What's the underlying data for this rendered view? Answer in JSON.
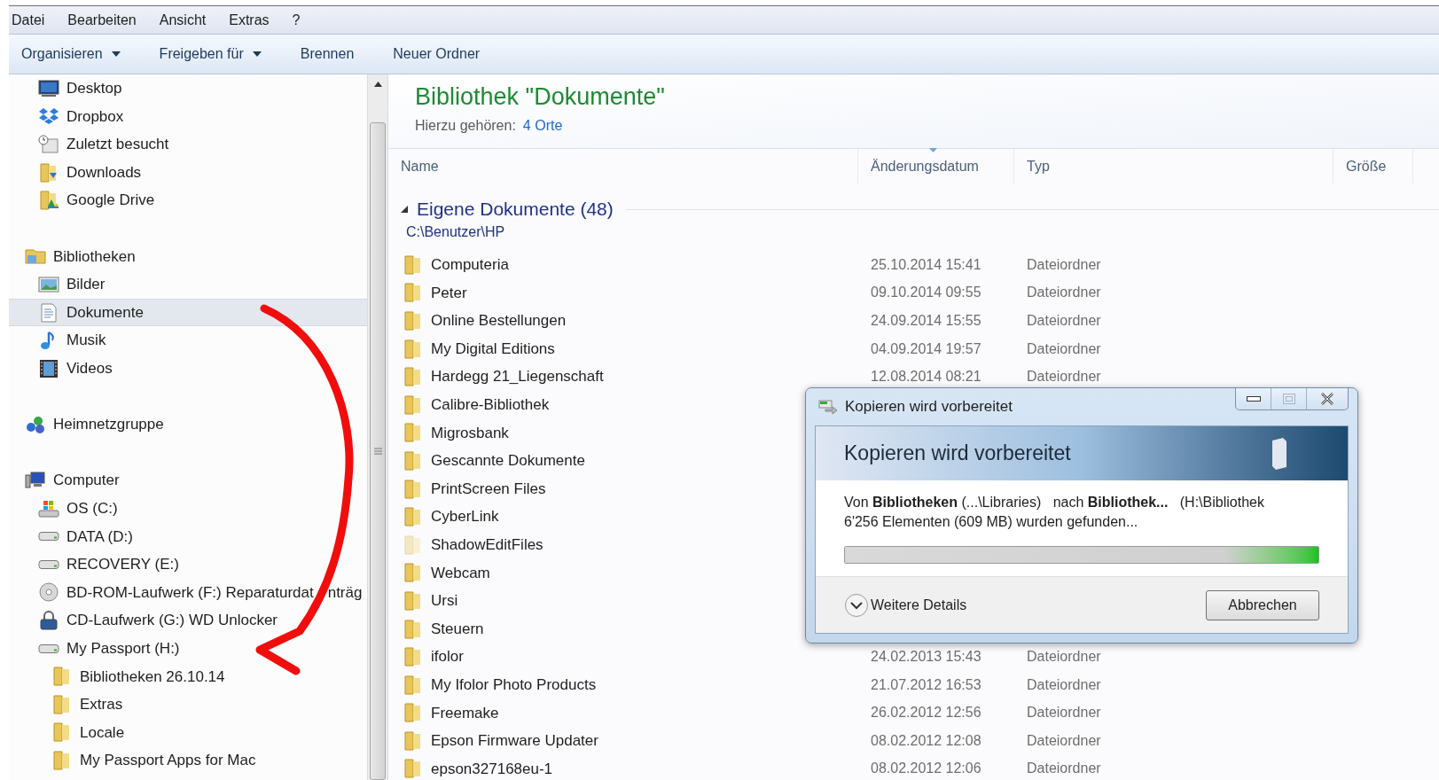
{
  "menu_bar": [
    "Datei",
    "Bearbeiten",
    "Ansicht",
    "Extras",
    "?"
  ],
  "toolbar": [
    {
      "label": "Organisieren",
      "dropdown": true
    },
    {
      "label": "Freigeben für",
      "dropdown": true
    },
    {
      "label": "Brennen",
      "dropdown": false
    },
    {
      "label": "Neuer Ordner",
      "dropdown": false
    }
  ],
  "sidebar": {
    "sections": [
      [
        {
          "label": "Desktop",
          "kind": "desktop",
          "selected": false
        },
        {
          "label": "Dropbox",
          "kind": "dropbox",
          "selected": false
        },
        {
          "label": "Zuletzt besucht",
          "kind": "recent",
          "selected": false
        },
        {
          "label": "Downloads",
          "kind": "downloads",
          "selected": false
        },
        {
          "label": "Google Drive",
          "kind": "gdrive",
          "selected": false
        }
      ],
      [
        {
          "label": "Bibliotheken",
          "kind": "library",
          "selected": false,
          "children": [
            {
              "label": "Bilder",
              "kind": "pictures",
              "selected": false
            },
            {
              "label": "Dokumente",
              "kind": "documents",
              "selected": true
            },
            {
              "label": "Musik",
              "kind": "music",
              "selected": false
            },
            {
              "label": "Videos",
              "kind": "videos",
              "selected": false
            }
          ]
        }
      ],
      [
        {
          "label": "Heimnetzgruppe",
          "kind": "homegroup",
          "selected": false
        }
      ],
      [
        {
          "label": "Computer",
          "kind": "computer",
          "selected": false,
          "children": [
            {
              "label": "OS (C:)",
              "kind": "osdrive",
              "selected": false
            },
            {
              "label": "DATA (D:)",
              "kind": "drive",
              "selected": false
            },
            {
              "label": "RECOVERY (E:)",
              "kind": "drive",
              "selected": false
            },
            {
              "label": "BD-ROM-Laufwerk (F:) Reparaturdat",
              "label_after_arrow": "nträg",
              "kind": "optical",
              "selected": false
            },
            {
              "label": "CD-Laufwerk (G:) WD Unlocker",
              "kind": "cdlock",
              "selected": false
            },
            {
              "label": "My Passport (H:)",
              "kind": "drive",
              "selected": false,
              "children": [
                {
                  "label": "Bibliotheken 26.10.14",
                  "kind": "folder",
                  "selected": false
                },
                {
                  "label": "Extras",
                  "kind": "folder",
                  "selected": false
                },
                {
                  "label": "Locale",
                  "kind": "folder",
                  "selected": false
                },
                {
                  "label": "My Passport Apps for Mac",
                  "kind": "folder",
                  "selected": false
                }
              ]
            }
          ]
        }
      ]
    ]
  },
  "library": {
    "title": "Bibliothek \"Dokumente\"",
    "includes_label": "Hierzu gehören:",
    "includes_link": "4 Orte"
  },
  "table": {
    "columns": [
      {
        "label": "Name",
        "sorted": false
      },
      {
        "label": "Änderungsdatum",
        "sorted": true
      },
      {
        "label": "Typ",
        "sorted": false
      },
      {
        "label": "Größe",
        "sorted": false
      }
    ],
    "group": {
      "title": "Eigene Dokumente (48)",
      "path": "C:\\Benutzer\\HP",
      "expanded": true
    },
    "rows": [
      {
        "name": "Computeria",
        "date": "25.10.2014 15:41",
        "type": "Dateiordner",
        "faded": false
      },
      {
        "name": "Peter",
        "date": "09.10.2014 09:55",
        "type": "Dateiordner",
        "faded": false
      },
      {
        "name": "Online Bestellungen",
        "date": "24.09.2014 15:55",
        "type": "Dateiordner",
        "faded": false
      },
      {
        "name": "My Digital Editions",
        "date": "04.09.2014 19:57",
        "type": "Dateiordner",
        "faded": false
      },
      {
        "name": "Hardegg 21_Liegenschaft",
        "date": "12.08.2014 08:21",
        "type": "Dateiordner",
        "faded": false
      },
      {
        "name": "Calibre-Bibliothek",
        "faded": false
      },
      {
        "name": "Migrosbank",
        "faded": false
      },
      {
        "name": "Gescannte Dokumente",
        "faded": false
      },
      {
        "name": "PrintScreen Files",
        "faded": false
      },
      {
        "name": "CyberLink",
        "faded": false
      },
      {
        "name": "ShadowEditFiles",
        "faded": true
      },
      {
        "name": "Webcam",
        "faded": false
      },
      {
        "name": "Ursi",
        "faded": false
      },
      {
        "name": "Steuern",
        "faded": false
      },
      {
        "name": "ifolor",
        "date": "24.02.2013 15:43",
        "type": "Dateiordner",
        "faded": false
      },
      {
        "name": "My Ifolor Photo Products",
        "date": "21.07.2012 16:53",
        "type": "Dateiordner",
        "faded": false
      },
      {
        "name": "Freemake",
        "date": "26.02.2012 12:56",
        "type": "Dateiordner",
        "faded": false
      },
      {
        "name": "Epson Firmware Updater",
        "date": "08.02.2012 12:08",
        "type": "Dateiordner",
        "faded": false
      },
      {
        "name": "epson327168eu-1",
        "date": "08.02.2012 12:06",
        "type": "Dateiordner",
        "faded": false
      }
    ]
  },
  "dialog": {
    "title": "Kopieren wird vorbereitet",
    "heading": "Kopieren wird vorbereitet",
    "line1": "Von **Bibliotheken** (...\\Libraries)   nach **Bibliothek...**   (H:\\Bibliothek",
    "line2": "6'256 Elementen (609 MB) wurden gefunden...",
    "level": 1,
    "details": "Weitere Details",
    "cancel": "Abbrechen"
  }
}
